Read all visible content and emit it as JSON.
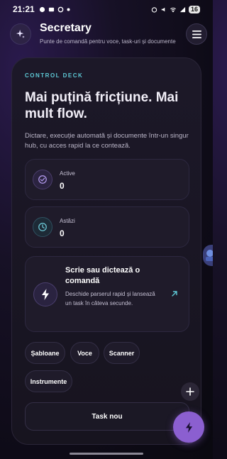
{
  "status_bar": {
    "time": "21:21",
    "battery": "16"
  },
  "header": {
    "title": "Secretary",
    "subtitle": "Punte de comandă pentru voce, task-uri și documente"
  },
  "control_deck": {
    "eyebrow": "CONTROL DECK",
    "headline": "Mai puțină fricțiune. Mai mult flow.",
    "description": "Dictare, execuție automată și documente într-un singur hub, cu acces rapid la ce contează."
  },
  "stats": [
    {
      "label": "Active",
      "value": "0",
      "icon": "check-circle-icon"
    },
    {
      "label": "Astăzi",
      "value": "0",
      "icon": "clock-icon"
    }
  ],
  "quick_action": {
    "title": "Scrie sau dictează o comandă",
    "description": "Deschide parserul rapid și lansează un task în câteva secunde.",
    "icon": "lightning-icon",
    "arrow_icon": "arrow-up-right-icon"
  },
  "chips": [
    "Șabloane",
    "Voce",
    "Scanner",
    "Instrumente"
  ],
  "task_button": "Task nou",
  "colors": {
    "accent_cyan": "#5ec9d6",
    "accent_purple": "#8b5fd0",
    "background": "#0e0b17"
  }
}
